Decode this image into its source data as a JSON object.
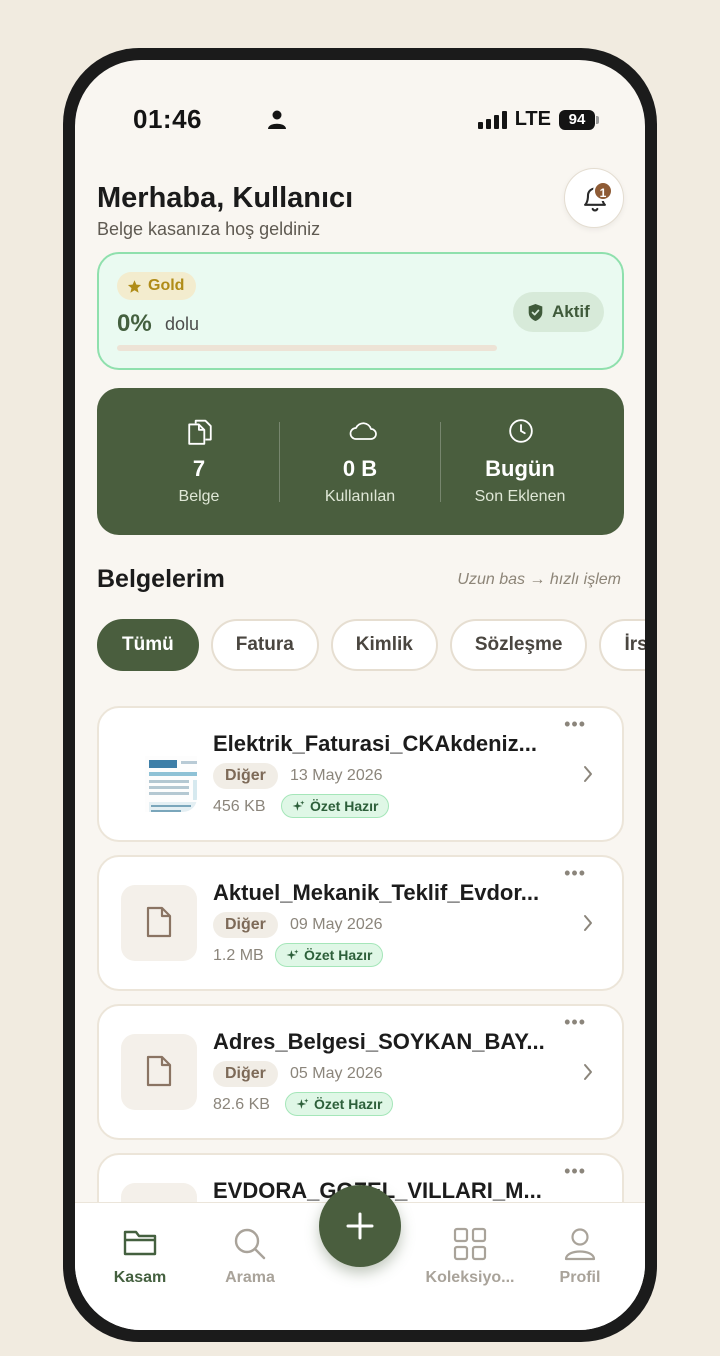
{
  "status_bar": {
    "time": "01:46",
    "network": "LTE",
    "battery": "94"
  },
  "header": {
    "greeting": "Merhaba, Kullanıcı",
    "subtitle": "Belge kasanıza hoş geldiniz",
    "notification_count": "1"
  },
  "plan": {
    "tier": "Gold",
    "usage_percent": "0%",
    "usage_label": "dolu",
    "usage_fraction": 0,
    "status": "Aktif"
  },
  "stats": [
    {
      "value": "7",
      "label": "Belge",
      "icon": "documents-icon"
    },
    {
      "value": "0 B",
      "label": "Kullanılan",
      "icon": "cloud-icon"
    },
    {
      "value": "Bugün",
      "label": "Son Eklenen",
      "icon": "clock-icon"
    }
  ],
  "section": {
    "title": "Belgelerim",
    "hint": "Uzun bas → hızlı işlem"
  },
  "filters": [
    "Tümü",
    "Fatura",
    "Kimlik",
    "Sözleşme",
    "İrsaliye"
  ],
  "documents": [
    {
      "name": "Elektrik_Faturasi_CKAkdeniz...",
      "type": "Diğer",
      "date": "13 May 2026",
      "size": "456 KB",
      "summary": "Özet Hazır",
      "thumbnail": "photo"
    },
    {
      "name": "Aktuel_Mekanik_Teklif_Evdor...",
      "type": "Diğer",
      "date": "09 May 2026",
      "size": "1.2 MB",
      "summary": "Özet Hazır",
      "thumbnail": "file-icon"
    },
    {
      "name": "Adres_Belgesi_SOYKAN_BAY...",
      "type": "Diğer",
      "date": "05 May 2026",
      "size": "82.6 KB",
      "summary": "Özet Hazır",
      "thumbnail": "file-icon"
    },
    {
      "name": "EVDORA_GOZEL_VILLARI_M...",
      "type": "",
      "date": "",
      "size": "",
      "summary": "",
      "thumbnail": "file-icon"
    }
  ],
  "nav": [
    {
      "label": "Kasam",
      "icon": "folder-icon",
      "active": true
    },
    {
      "label": "Arama",
      "icon": "search-icon",
      "active": false
    },
    {
      "label": "Koleksiyo...",
      "icon": "grid-icon",
      "active": false
    },
    {
      "label": "Profil",
      "icon": "user-icon",
      "active": false
    }
  ],
  "colors": {
    "primary": "#4a5e3e",
    "background": "#f9f6f1",
    "accent_green": "#8fe0ad",
    "gold": "#b08c18"
  }
}
